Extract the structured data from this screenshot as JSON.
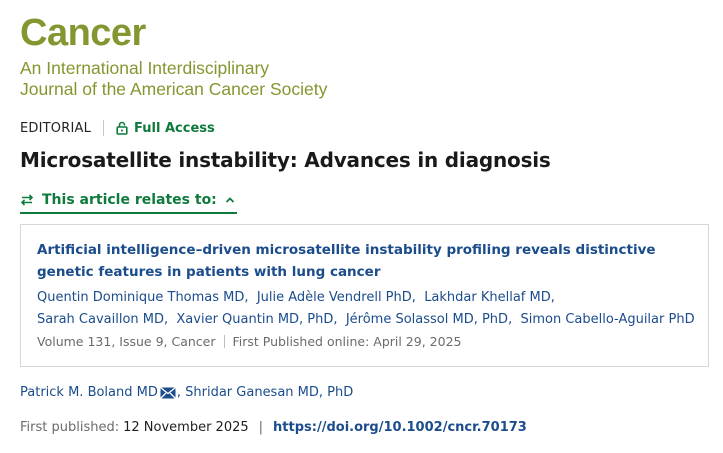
{
  "journal": {
    "name": "Cancer",
    "subtitle_line1": "An International Interdisciplinary",
    "subtitle_line2": "Journal of the American Cancer Society"
  },
  "article": {
    "type": "EDITORIAL",
    "access": "Full Access",
    "title": "Microsatellite instability: Advances in diagnosis",
    "relates_label": "This article relates to:"
  },
  "related": {
    "title": "Artificial intelligence–driven microsatellite instability profiling reveals distinctive genetic features in patients with lung cancer",
    "authors": [
      "Quentin Dominique Thomas MD",
      "Julie Adèle Vendrell PhD",
      "Lakhdar Khellaf MD",
      "Sarah Cavaillon MD",
      "Xavier Quantin MD, PhD",
      "Jérôme Solassol MD, PhD",
      "Simon Cabello-Aguilar PhD"
    ],
    "volume": "Volume 131",
    "issue": "Issue 9",
    "journal": "Cancer",
    "first_published_online": "First Published online: April 29, 2025"
  },
  "authors": {
    "first": "Patrick M. Boland MD",
    "second": "Shridar Ganesan MD, PhD"
  },
  "publication": {
    "label": "First published:",
    "date": "12 November 2025",
    "separator": "|",
    "doi": "https://doi.org/10.1002/cncr.70173"
  },
  "colors": {
    "journal_green": "#839730",
    "access_green": "#0f7a3c",
    "link_blue": "#1b4c8c"
  },
  "icons": {
    "access": "lock-icon",
    "relates": "swap-arrows-icon",
    "toggle": "chevron-up-icon",
    "email": "envelope-icon"
  }
}
